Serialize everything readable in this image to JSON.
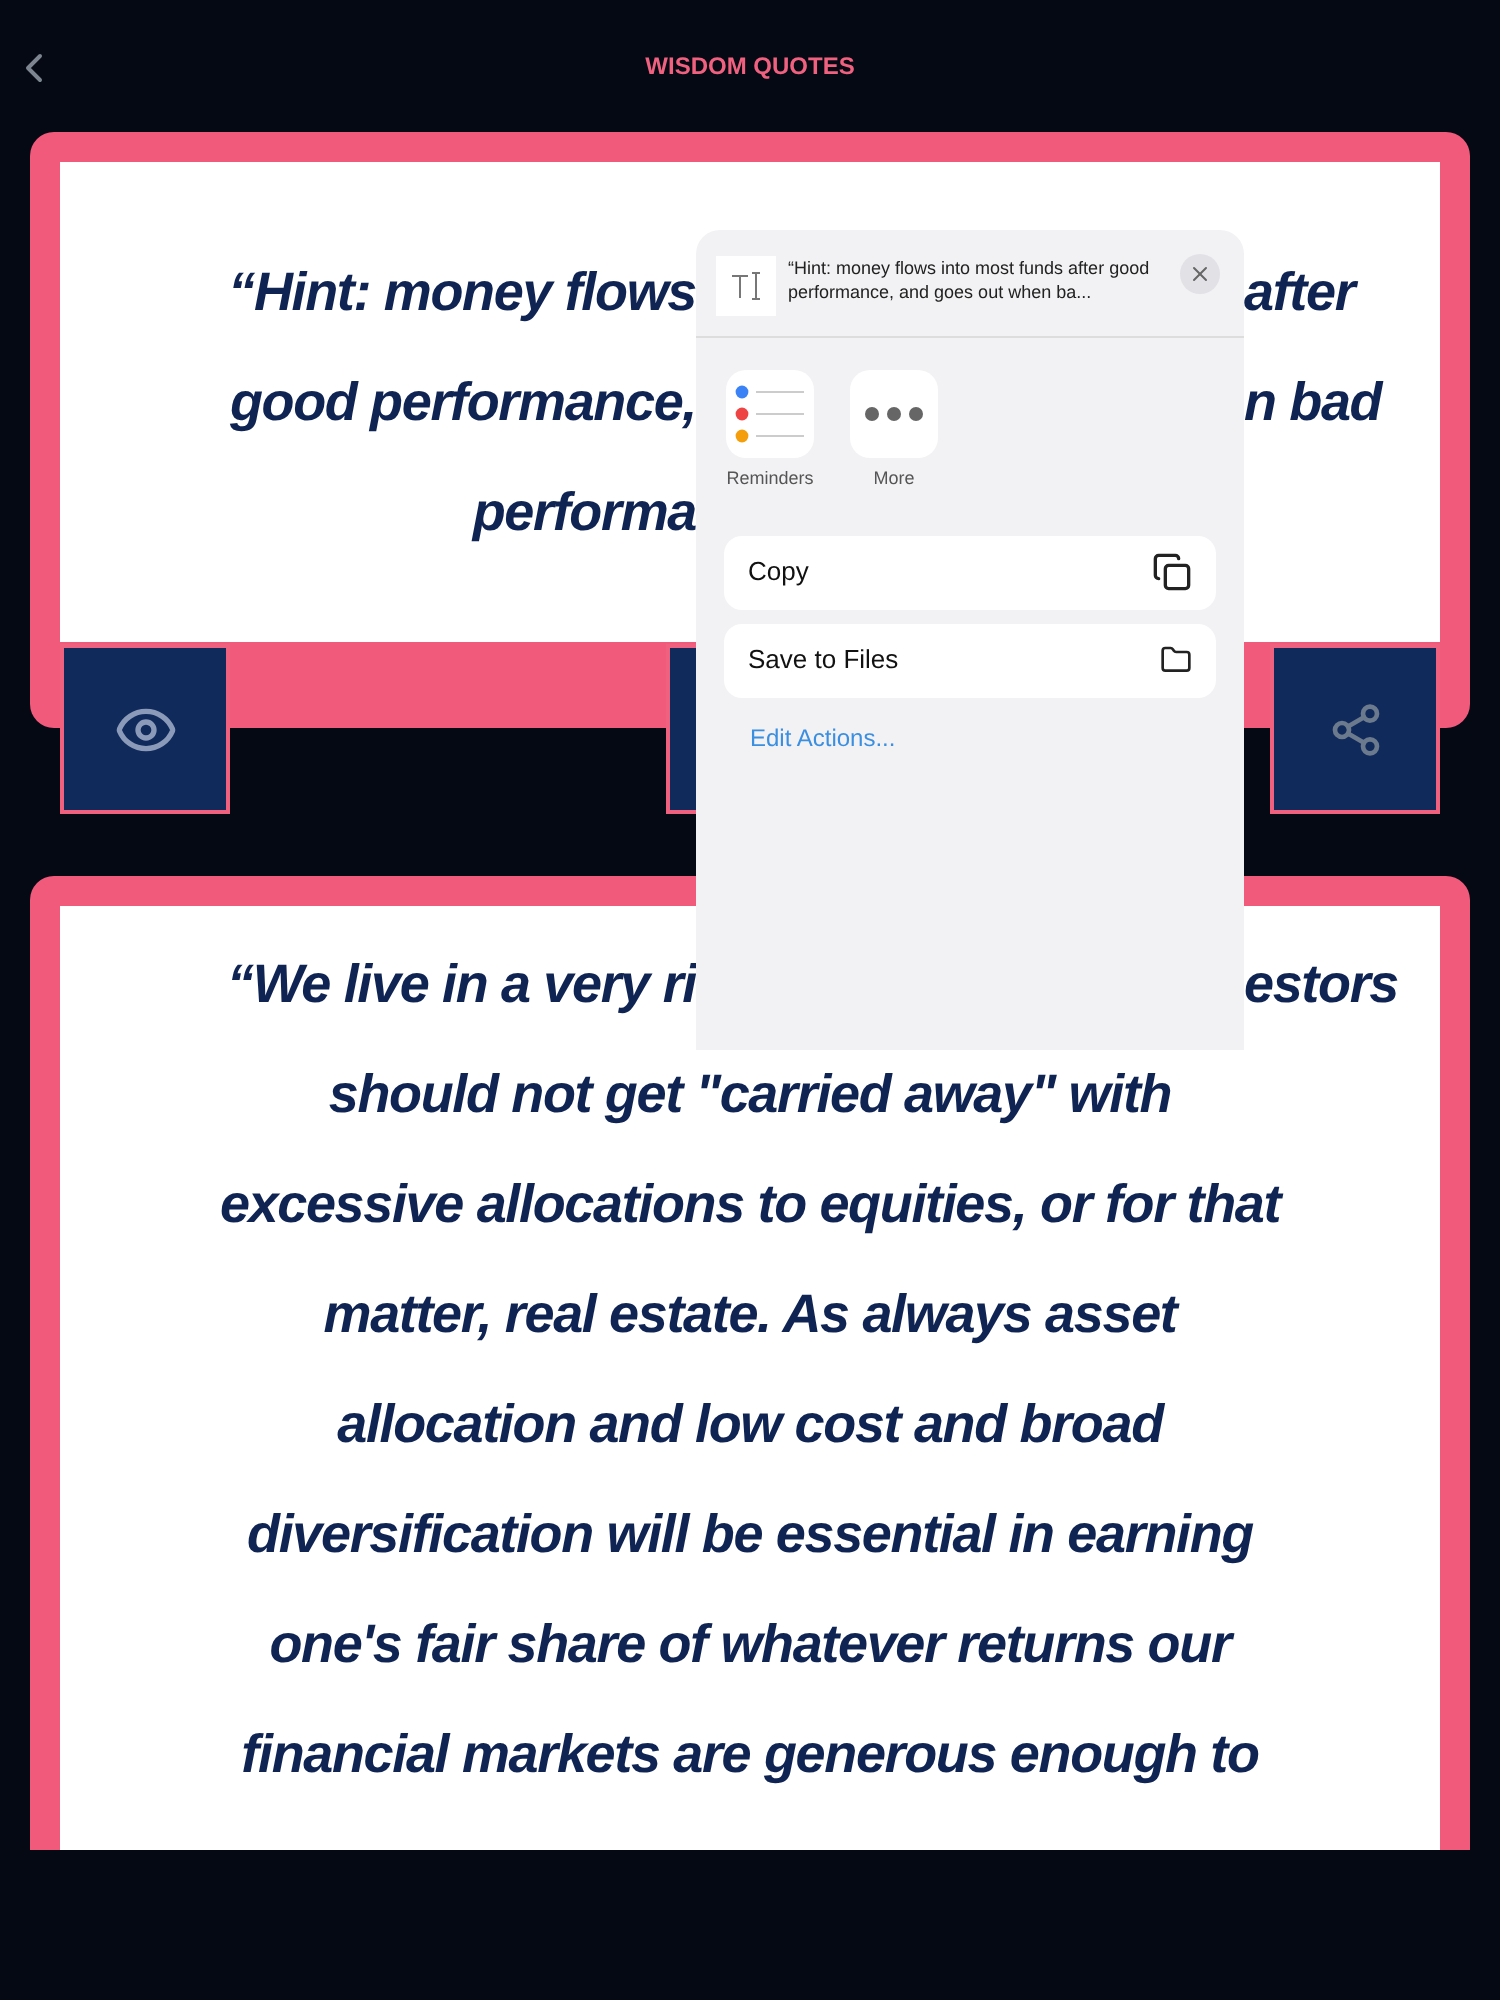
{
  "header": {
    "title": "WISDOM QUOTES"
  },
  "quotes": [
    {
      "lines": [
        {
          "left": "“Hint: money flows",
          "right": "after"
        },
        {
          "left": "good performance,",
          "right": "n bad"
        },
        {
          "left": "performa"
        }
      ],
      "buttons": [
        {
          "kind": "view"
        },
        {
          "kind": "middle"
        },
        {
          "kind": "share"
        }
      ]
    },
    {
      "lines": [
        {
          "left": "“We live in a very ri",
          "right": "estors"
        },
        {
          "text": "should not get \"carried away\" with"
        },
        {
          "text": "excessive allocations to equities, or for that"
        },
        {
          "text": "matter, real estate. As always asset"
        },
        {
          "text": "allocation and low cost and broad"
        },
        {
          "text": "diversification will be essential in earning"
        },
        {
          "text": "one's fair share of whatever returns our"
        },
        {
          "text": "financial markets are generous enough to"
        }
      ]
    }
  ],
  "share_sheet": {
    "preview": "“Hint: money flows into most funds after good performance, and goes out when ba...",
    "apps": [
      {
        "label": "Reminders",
        "kind": "reminders"
      },
      {
        "label": "More",
        "kind": "more"
      }
    ],
    "actions": [
      {
        "label": "Copy",
        "kind": "copy"
      },
      {
        "label": "Save to Files",
        "kind": "files"
      }
    ],
    "edit_link": "Edit Actions..."
  }
}
